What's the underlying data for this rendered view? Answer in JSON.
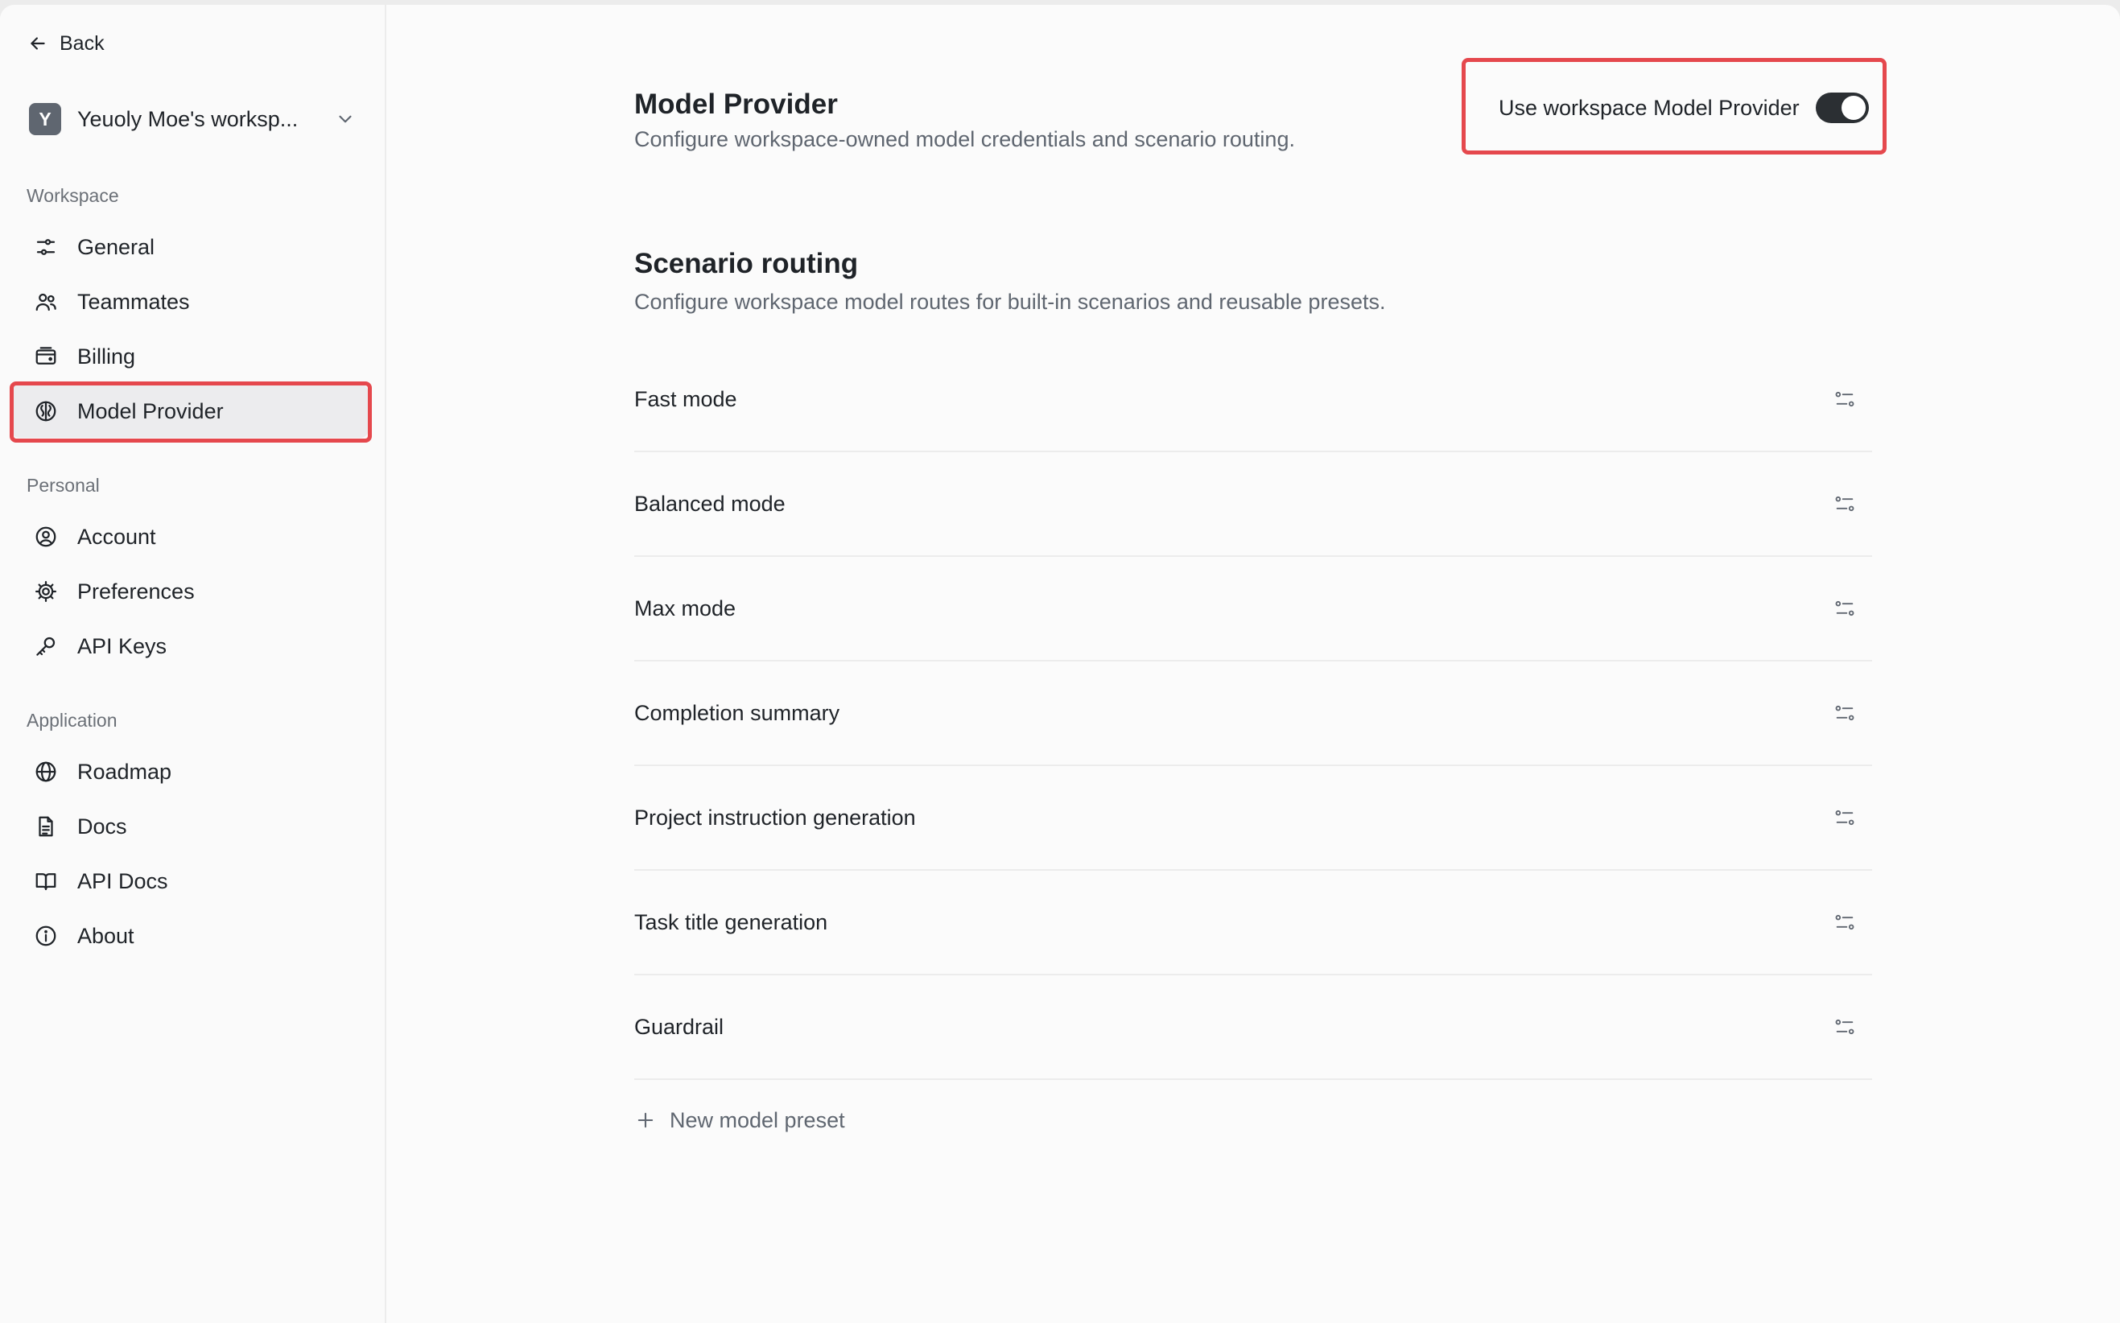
{
  "sidebar": {
    "back_label": "Back",
    "workspace": {
      "avatar_letter": "Y",
      "name": "Yeuoly Moe's worksp..."
    },
    "sections": {
      "workspace": "Workspace",
      "personal": "Personal",
      "application": "Application"
    },
    "items": {
      "general": "General",
      "teammates": "Teammates",
      "billing": "Billing",
      "model_provider": "Model Provider",
      "account": "Account",
      "preferences": "Preferences",
      "api_keys": "API Keys",
      "roadmap": "Roadmap",
      "docs": "Docs",
      "api_docs": "API Docs",
      "about": "About"
    },
    "active_item": "model_provider"
  },
  "main": {
    "title": "Model Provider",
    "subtitle": "Configure workspace-owned model credentials and scenario routing.",
    "toggle": {
      "label": "Use workspace Model Provider",
      "enabled": true
    },
    "routing": {
      "title": "Scenario routing",
      "subtitle": "Configure workspace model routes for built-in scenarios and reusable presets.",
      "rows": [
        "Fast mode",
        "Balanced mode",
        "Max mode",
        "Completion summary",
        "Project instruction generation",
        "Task title generation",
        "Guardrail"
      ],
      "new_preset_label": "New model preset"
    }
  },
  "colors": {
    "highlight": "#e5484d",
    "toggle_on": "#2b2f33",
    "active_bg": "#ececee"
  }
}
